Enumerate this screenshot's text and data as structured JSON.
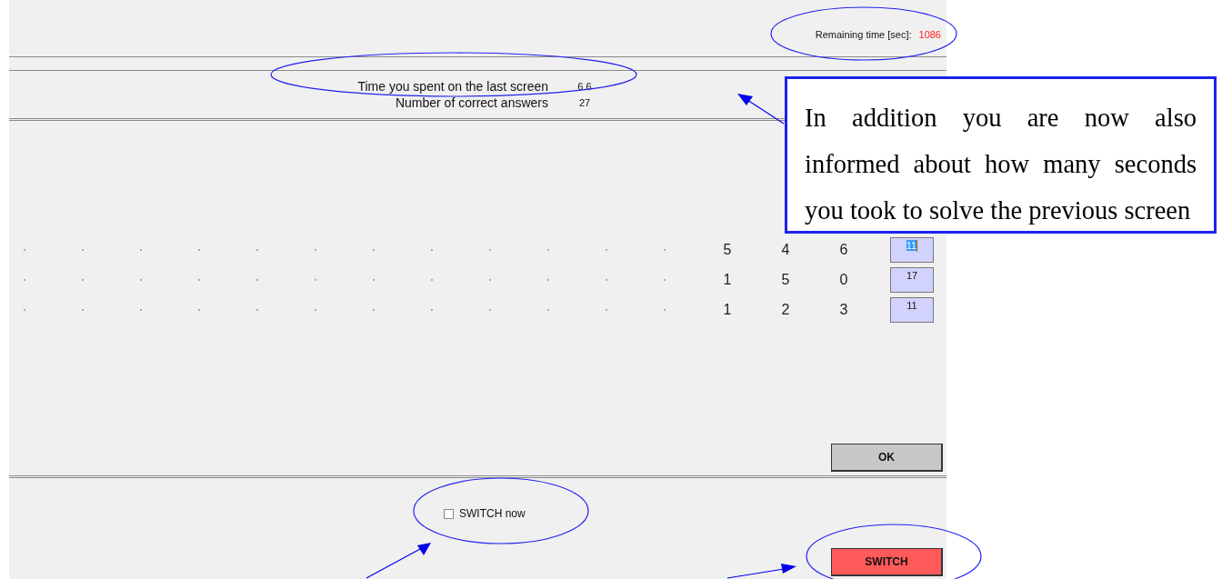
{
  "header": {
    "remaining_label": "Remaining time [sec]:",
    "remaining_value": "1086"
  },
  "info": [
    {
      "label": "Time you spent on the last screen",
      "value": "6.6"
    },
    {
      "label": "Number of correct answers",
      "value": "27"
    }
  ],
  "task_rows": [
    {
      "numbers": [
        "5",
        "4",
        "6"
      ],
      "answer": "11",
      "focused": true
    },
    {
      "numbers": [
        "1",
        "5",
        "0"
      ],
      "answer": "17",
      "focused": false
    },
    {
      "numbers": [
        "1",
        "2",
        "3"
      ],
      "answer": "11",
      "focused": false
    }
  ],
  "ok_button": "OK",
  "switch_checkbox": {
    "label": "SWITCH now",
    "checked": false
  },
  "switch_button": "SWITCH",
  "callout": "In addition you are now also informed about how many seconds you took to solve the previous screen"
}
